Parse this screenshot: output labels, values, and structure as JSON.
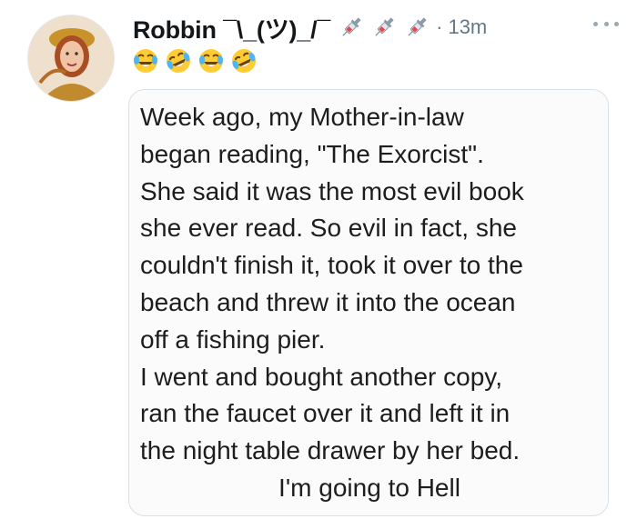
{
  "tweet": {
    "author": {
      "display_name": "Robbin ¯\\_(ツ)_/¯",
      "avatar_icon": "avatar-photo"
    },
    "timestamp": "13m",
    "timestamp_separator": "·",
    "flair_icons": [
      "syringe-icon",
      "syringe-icon",
      "syringe-icon"
    ],
    "emoji_row": [
      "laughing-tears-icon",
      "rolling-laughing-icon",
      "laughing-tears-icon",
      "rolling-laughing-icon"
    ],
    "more_icon": "more-dots-icon",
    "image_text": {
      "lines": [
        "Week ago, my Mother-in-law",
        "began reading, \"The Exorcist\".",
        "She said it was the most evil book",
        "she ever read. So evil in fact, she",
        "couldn't finish it, took it over to the",
        "beach and threw it into the ocean",
        "off a fishing pier.",
        "I went and bought another copy,",
        "ran the faucet over it and left it in",
        "the night table drawer by her bed.",
        "I'm going to Hell"
      ]
    }
  }
}
